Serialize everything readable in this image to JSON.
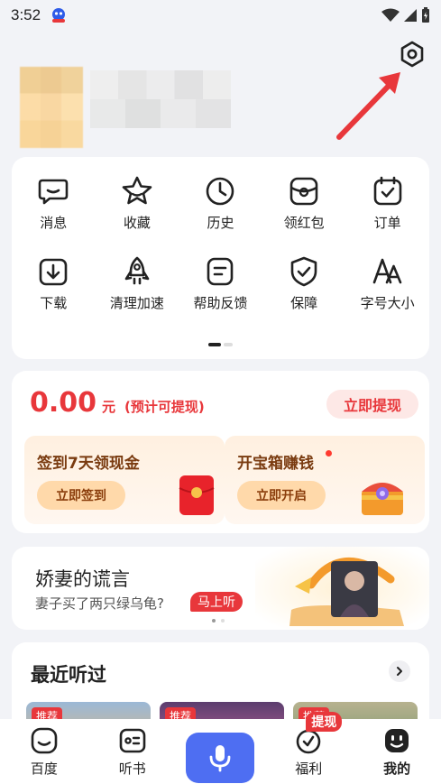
{
  "status_bar": {
    "time": "3:52"
  },
  "menu_grid": {
    "items": [
      {
        "label": "消息",
        "icon": "message-icon"
      },
      {
        "label": "收藏",
        "icon": "star-icon"
      },
      {
        "label": "历史",
        "icon": "clock-icon"
      },
      {
        "label": "领红包",
        "icon": "red-packet-icon"
      },
      {
        "label": "订单",
        "icon": "order-icon"
      },
      {
        "label": "下载",
        "icon": "download-icon"
      },
      {
        "label": "清理加速",
        "icon": "rocket-icon"
      },
      {
        "label": "帮助反馈",
        "icon": "feedback-icon"
      },
      {
        "label": "保障",
        "icon": "shield-icon"
      },
      {
        "label": "字号大小",
        "icon": "font-size-icon"
      }
    ]
  },
  "earnings": {
    "amount": "0.00",
    "unit": "元",
    "note": "(预计可提现)",
    "withdraw_label": "立即提现",
    "tasks": [
      {
        "title": "签到7天领现金",
        "button": "立即签到"
      },
      {
        "title": "开宝箱赚钱",
        "button": "立即开启"
      }
    ]
  },
  "banner": {
    "title": "娇妻的谎言",
    "subtitle": "妻子买了两只绿乌龟?",
    "tag": "马上听"
  },
  "recent": {
    "title": "最近听过",
    "covers": [
      {
        "tag": "推荐"
      },
      {
        "tag": "推荐"
      },
      {
        "tag": "推荐"
      }
    ]
  },
  "tab_bar": {
    "tabs": [
      {
        "label": "百度"
      },
      {
        "label": "听书"
      },
      {
        "label": ""
      },
      {
        "label": "福利",
        "badge": "提现"
      },
      {
        "label": "我的"
      }
    ]
  },
  "colors": {
    "accent_red": "#e8373b",
    "accent_blue": "#4e6ef2"
  }
}
